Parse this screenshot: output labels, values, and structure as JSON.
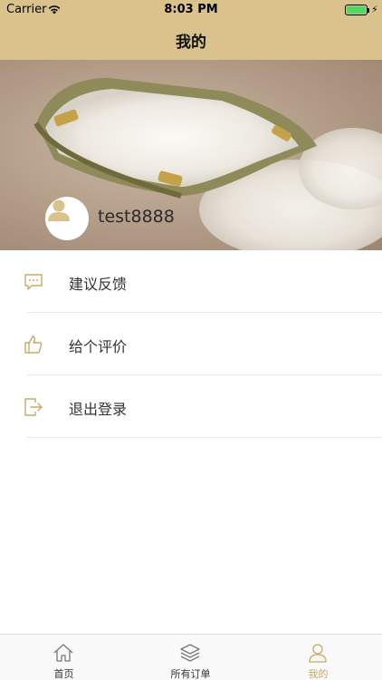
{
  "status_bar": {
    "carrier": "Carrier",
    "time": "8:03 PM"
  },
  "header": {
    "title": "我的"
  },
  "profile": {
    "username": "test8888"
  },
  "menu": {
    "items": [
      {
        "label": "建议反馈",
        "icon": "chat-bubble-icon"
      },
      {
        "label": "给个评价",
        "icon": "thumbs-up-icon"
      },
      {
        "label": "退出登录",
        "icon": "logout-icon"
      }
    ]
  },
  "tabbar": {
    "tabs": [
      {
        "label": "首页",
        "icon": "home-icon"
      },
      {
        "label": "所有订单",
        "icon": "layers-icon"
      },
      {
        "label": "我的",
        "icon": "person-icon",
        "active": true
      }
    ]
  },
  "colors": {
    "header_bg": "#d9c28c",
    "accent": "#c9a86a",
    "battery": "#4cd964"
  }
}
